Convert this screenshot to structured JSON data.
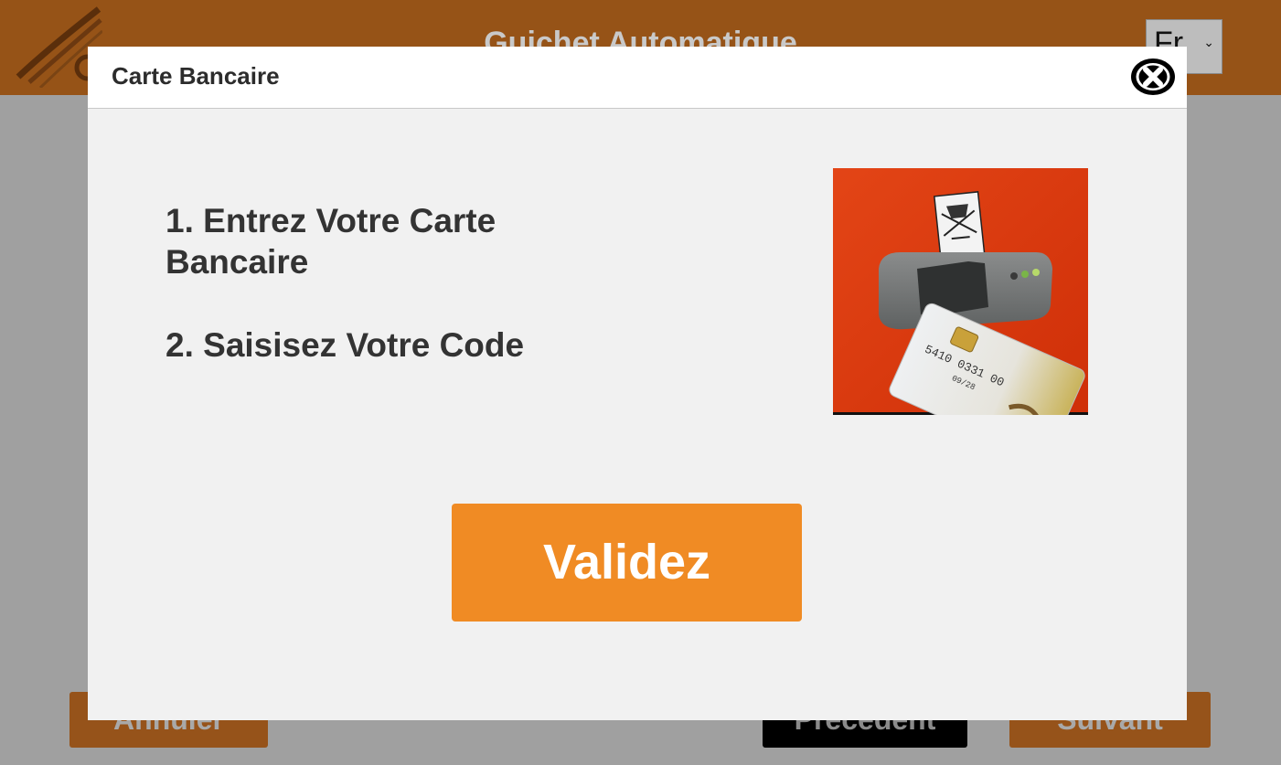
{
  "app": {
    "title": "Guichet Automatique",
    "language": "Fr"
  },
  "footer": {
    "cancel_label": "Annuler",
    "previous_label": "Précédent",
    "next_label": "Suivant"
  },
  "modal": {
    "title": "Carte Bancaire",
    "steps": [
      "1. Entrez Votre Carte Bancaire",
      "2. Saisisez Votre Code"
    ],
    "validate_label": "Validez"
  },
  "card": {
    "number_fragment": "5410 0331 00",
    "expiry": "09/28"
  },
  "colors": {
    "header_bg": "#965317",
    "accent": "#f08b24",
    "overlay": "#a0a0a0",
    "modal_bg": "#f1f1f1"
  },
  "icons": {
    "close": "close-circle-icon",
    "logo": "swoosh-logo"
  }
}
